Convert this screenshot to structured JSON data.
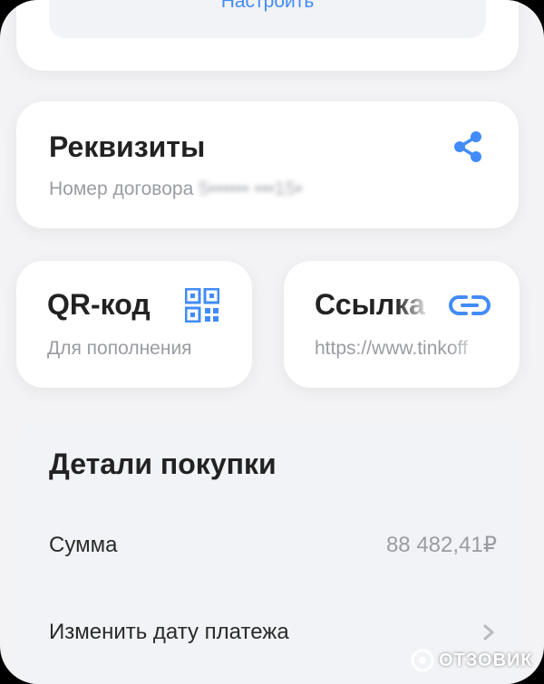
{
  "top_card": {
    "configure_label": "Настроить"
  },
  "requisites": {
    "title": "Реквизиты",
    "contract_label": "Номер договора",
    "contract_number_masked": "5•••••• •••15•",
    "icon": "share-icon"
  },
  "qr": {
    "title": "QR-код",
    "subtitle": "Для пополнения",
    "icon": "qr-code-icon"
  },
  "link": {
    "title": "Ссылка",
    "subtitle": "https://www.tinkoff",
    "icon": "link-icon"
  },
  "details": {
    "title": "Детали покупки",
    "sum_label": "Сумма",
    "sum_value": "88 482,41₽",
    "change_date_label": "Изменить дату платежа"
  },
  "watermark": {
    "text": "ОТЗОВИК"
  },
  "colors": {
    "accent": "#428bf9",
    "background": "#f3f3f5",
    "card": "#ffffff",
    "details_card": "#f2f3f6",
    "text_primary": "#222222",
    "text_secondary": "#9a9ca3"
  }
}
